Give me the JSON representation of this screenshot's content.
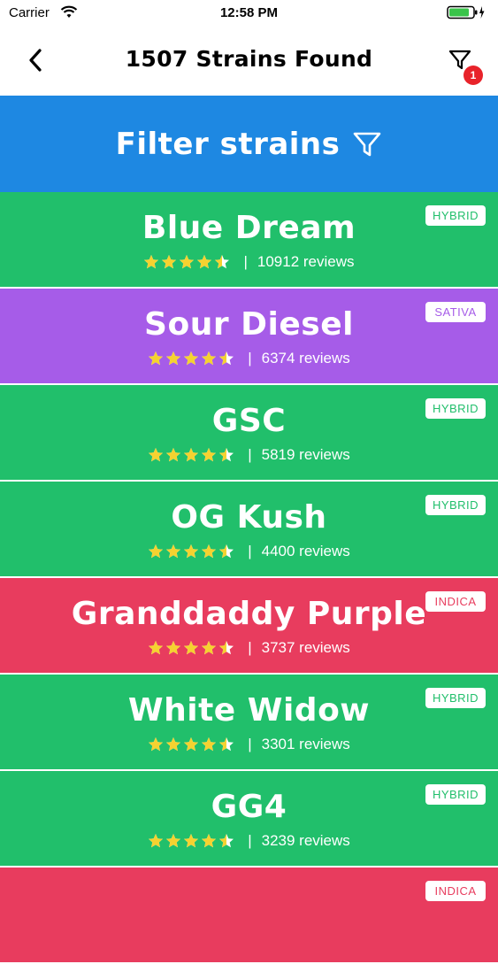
{
  "status_bar": {
    "carrier": "Carrier",
    "time": "12:58 PM"
  },
  "nav": {
    "title": "1507 Strains Found",
    "filter_badge": "1",
    "icons": {
      "back": "chevron-left-icon",
      "filter": "filter-icon"
    }
  },
  "filter_banner": {
    "label": "Filter strains",
    "icon": "filter-icon",
    "color": "#1e88e2"
  },
  "colors": {
    "hybrid": "#21bf6b",
    "sativa": "#a65ce8",
    "indica": "#e83c5e",
    "star": "#f5d230"
  },
  "strains": [
    {
      "name": "Blue Dream",
      "rating": 4.5,
      "reviews": "10912 reviews",
      "type": "HYBRID",
      "color": "#21bf6b"
    },
    {
      "name": "Sour Diesel",
      "rating": 4.5,
      "reviews": "6374 reviews",
      "type": "SATIVA",
      "color": "#a65ce8"
    },
    {
      "name": "GSC",
      "rating": 4.5,
      "reviews": "5819 reviews",
      "type": "HYBRID",
      "color": "#21bf6b"
    },
    {
      "name": "OG Kush",
      "rating": 4.5,
      "reviews": "4400 reviews",
      "type": "HYBRID",
      "color": "#21bf6b"
    },
    {
      "name": "Granddaddy Purple",
      "rating": 4.5,
      "reviews": "3737 reviews",
      "type": "INDICA",
      "color": "#e83c5e"
    },
    {
      "name": "White Widow",
      "rating": 4.5,
      "reviews": "3301 reviews",
      "type": "HYBRID",
      "color": "#21bf6b"
    },
    {
      "name": "GG4",
      "rating": 4.5,
      "reviews": "3239 reviews",
      "type": "HYBRID",
      "color": "#21bf6b"
    },
    {
      "name": "",
      "rating": 4.5,
      "reviews": "",
      "type": "INDICA",
      "color": "#e83c5e"
    }
  ]
}
